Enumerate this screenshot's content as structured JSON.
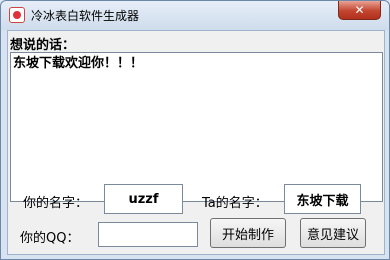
{
  "window": {
    "title": "冷冰表白软件生成器",
    "close_glyph": "✕"
  },
  "message": {
    "label": "想说的话：",
    "value": "东坡下载欢迎你！！！"
  },
  "form": {
    "your_name_label": "你的名字：",
    "your_name_value": "uzzf",
    "ta_name_label": "Ta的名字：",
    "ta_name_value": "东坡下载",
    "qq_label": "你的QQ：",
    "qq_value": ""
  },
  "buttons": {
    "start_label": "开始制作",
    "feedback_label": "意见建议"
  },
  "colors": {
    "title_bar": "#d3dfee",
    "close_button": "#c2452f"
  }
}
